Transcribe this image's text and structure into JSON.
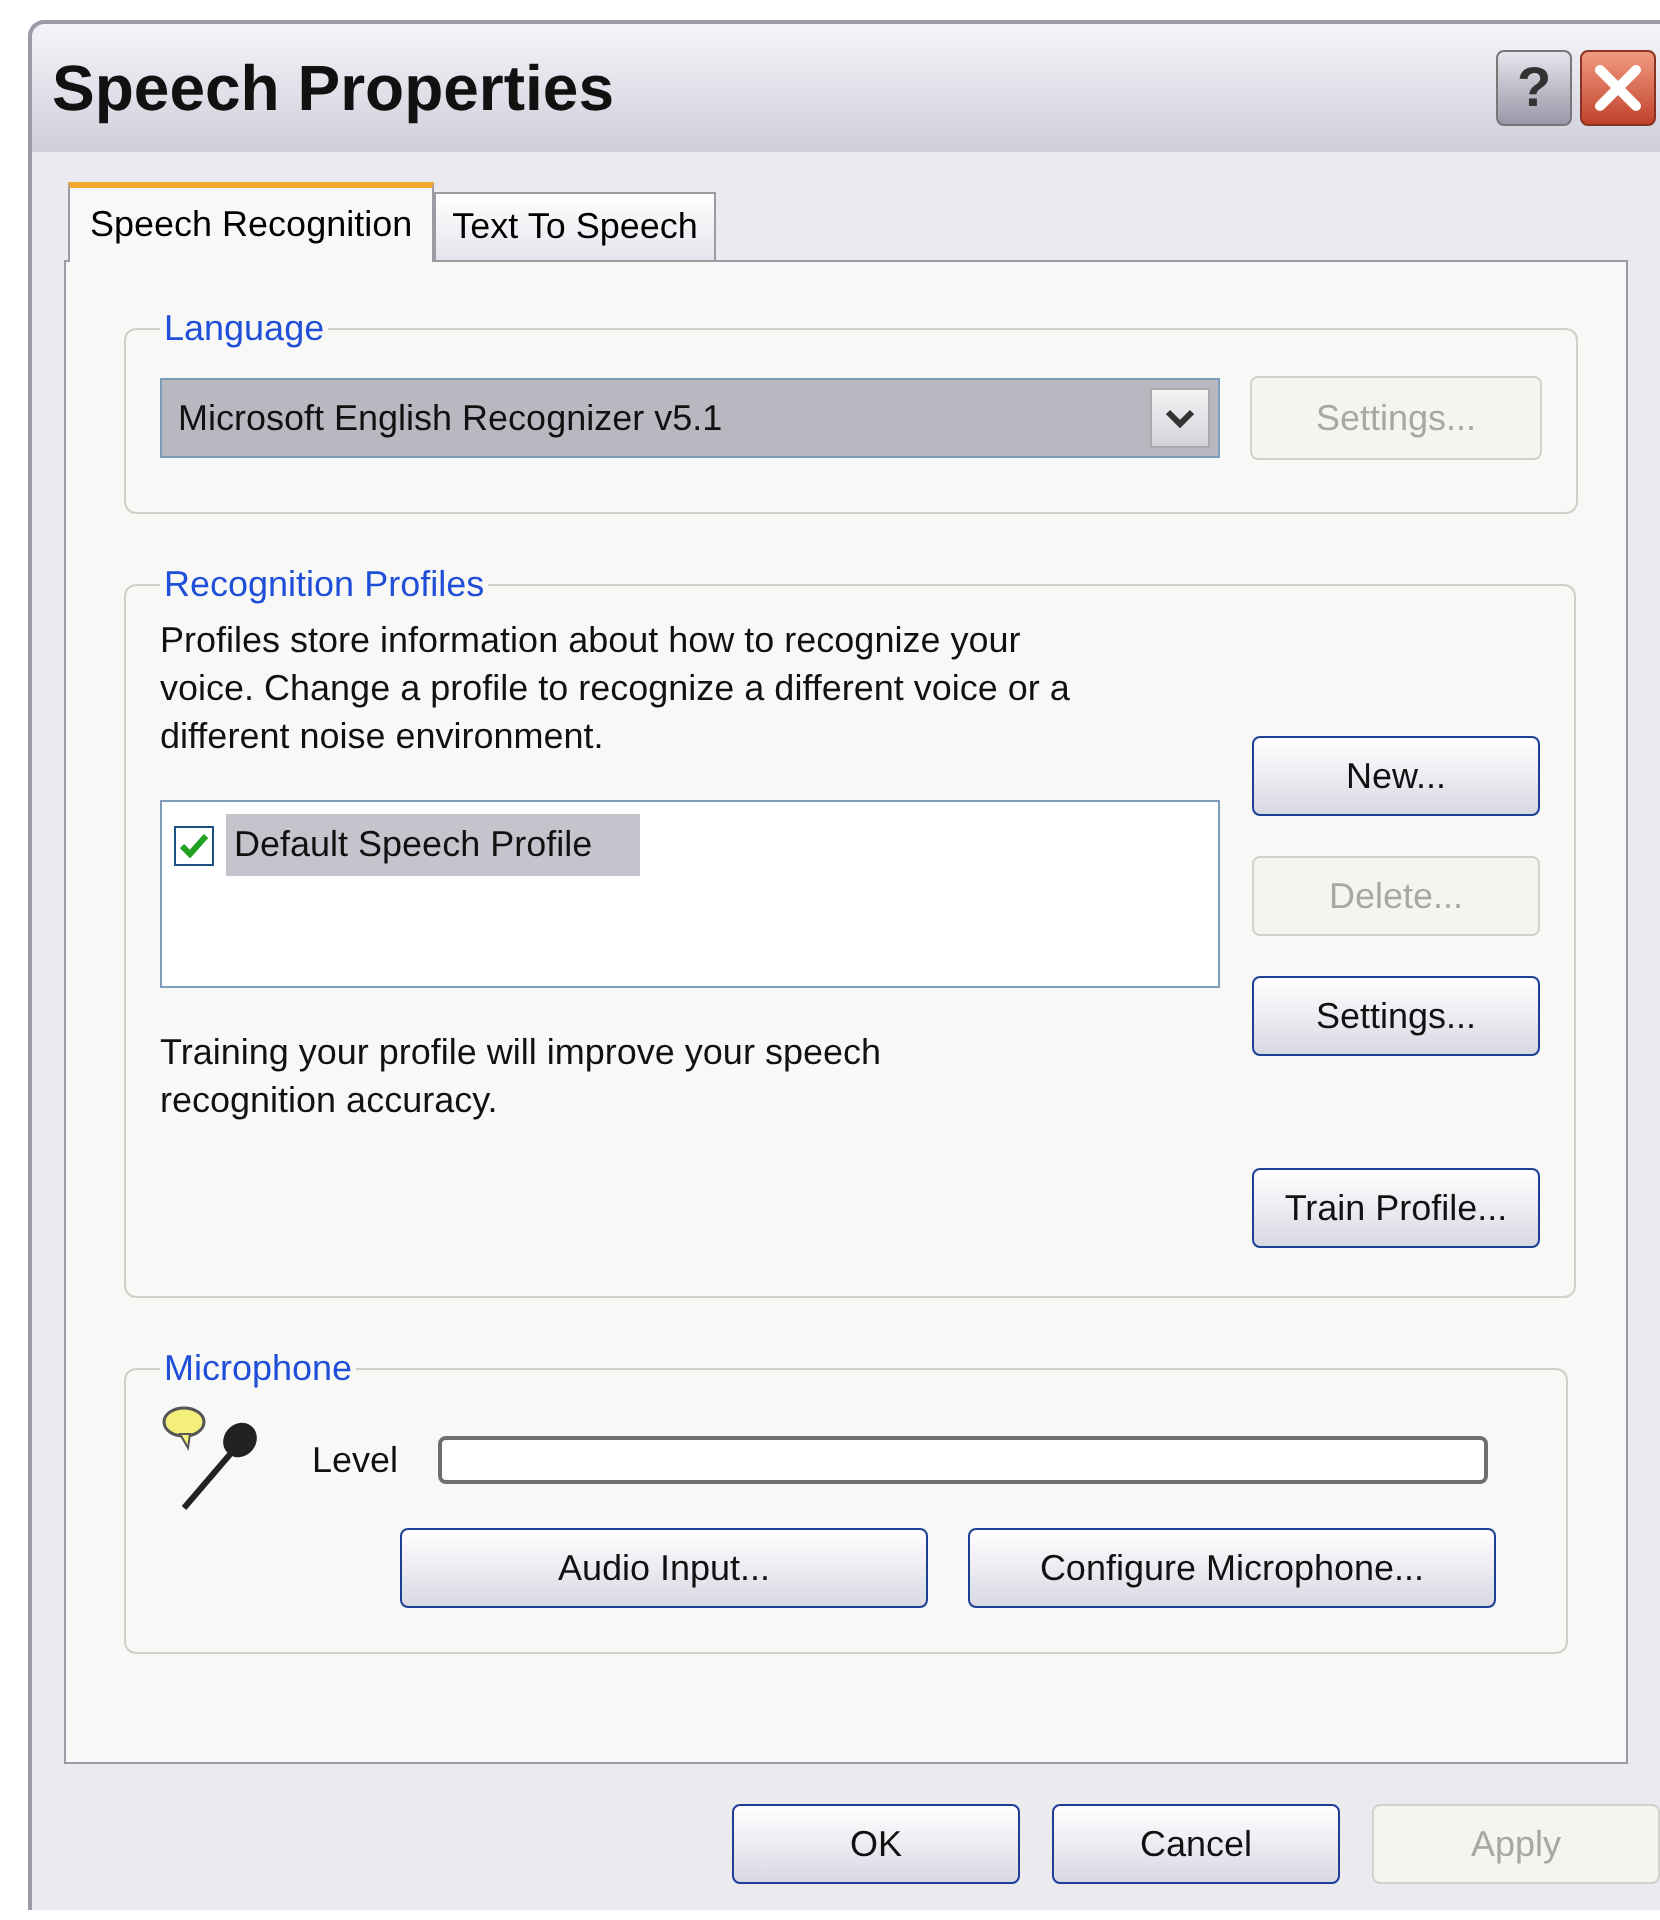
{
  "window": {
    "title": "Speech Properties",
    "help_button": "?"
  },
  "tabs": [
    {
      "label": "Speech Recognition",
      "selected": true
    },
    {
      "label": "Text To Speech",
      "selected": false
    }
  ],
  "language": {
    "title": "Language",
    "recognizer": "Microsoft English Recognizer v5.1",
    "settings_button": {
      "label": "Settings...",
      "disabled": true
    }
  },
  "recognition_profiles": {
    "title": "Recognition Profiles",
    "description": "Profiles store information about how to recognize your voice.  Change a profile to recognize a different voice or a different noise environment.",
    "profiles": [
      {
        "name": "Default Speech Profile",
        "checked": true,
        "selected": true
      }
    ],
    "buttons": [
      {
        "label": "New...",
        "disabled": false
      },
      {
        "label": "Delete...",
        "disabled": true
      },
      {
        "label": "Settings...",
        "disabled": false
      }
    ],
    "training_text": "Training your profile will improve your speech recognition accuracy.",
    "train_button": {
      "label": "Train Profile...",
      "disabled": false
    }
  },
  "microphone": {
    "title": "Microphone",
    "level_label": "Level",
    "level": 0,
    "buttons": [
      {
        "label": "Audio Input...",
        "disabled": false
      },
      {
        "label": "Configure Microphone...",
        "disabled": false
      }
    ]
  },
  "dialog_buttons": [
    {
      "label": "OK",
      "disabled": false
    },
    {
      "label": "Cancel",
      "disabled": false
    },
    {
      "label": "Apply",
      "disabled": true
    }
  ]
}
